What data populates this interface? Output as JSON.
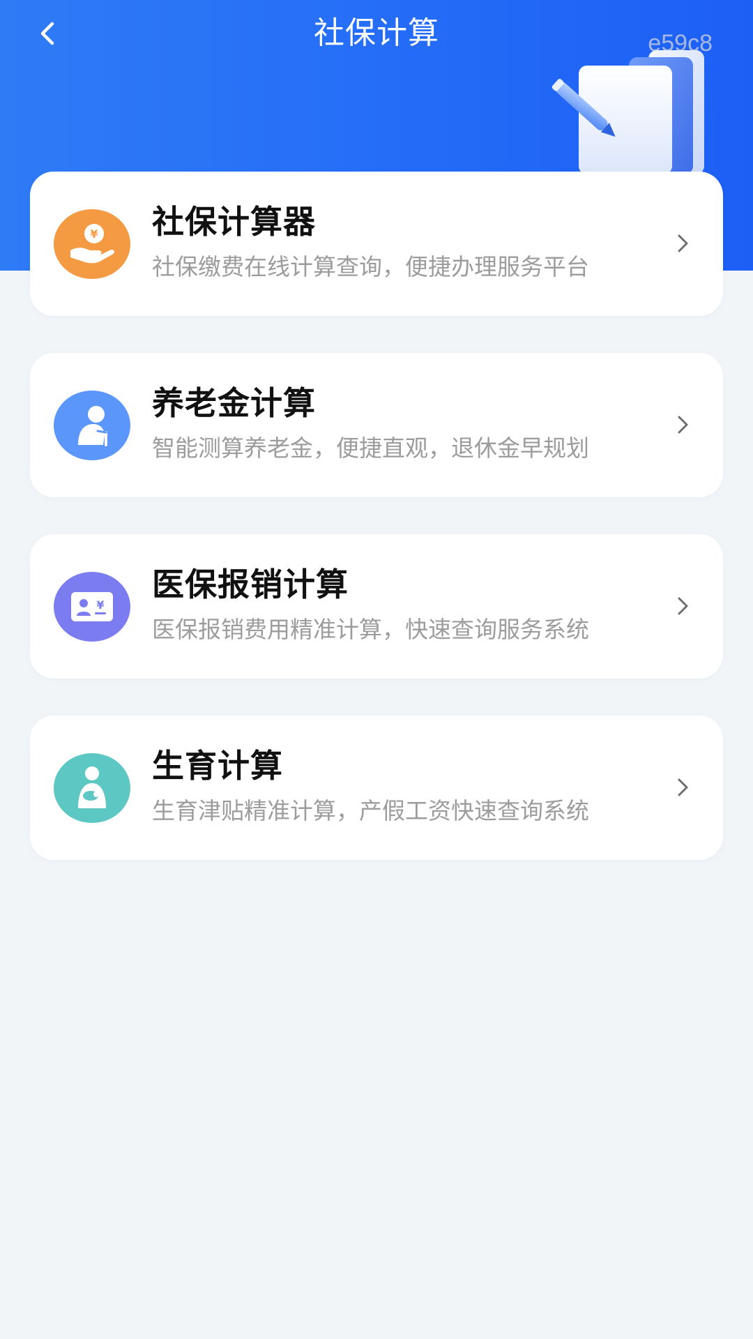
{
  "header": {
    "title": "社保计算",
    "watermark": "e59c8",
    "back_icon": "chevron-left-icon",
    "background_color": "#246cf7"
  },
  "cards": [
    {
      "title": "社保计算器",
      "description": "社保缴费在线计算查询，便捷办理服务平台",
      "icon": "hand-coin-icon",
      "icon_color": "#f39a43"
    },
    {
      "title": "养老金计算",
      "description": "智能测算养老金，便捷直观，退休金早规划",
      "icon": "elderly-person-icon",
      "icon_color": "#5b96fb"
    },
    {
      "title": "医保报销计算",
      "description": "医保报销费用精准计算，快速查询服务系统",
      "icon": "medical-card-icon",
      "icon_color": "#7b7cf0"
    },
    {
      "title": "生育计算",
      "description": "生育津贴精准计算，产假工资快速查询系统",
      "icon": "mother-baby-icon",
      "icon_color": "#5cc7c3"
    }
  ],
  "coin_symbol": "¥"
}
